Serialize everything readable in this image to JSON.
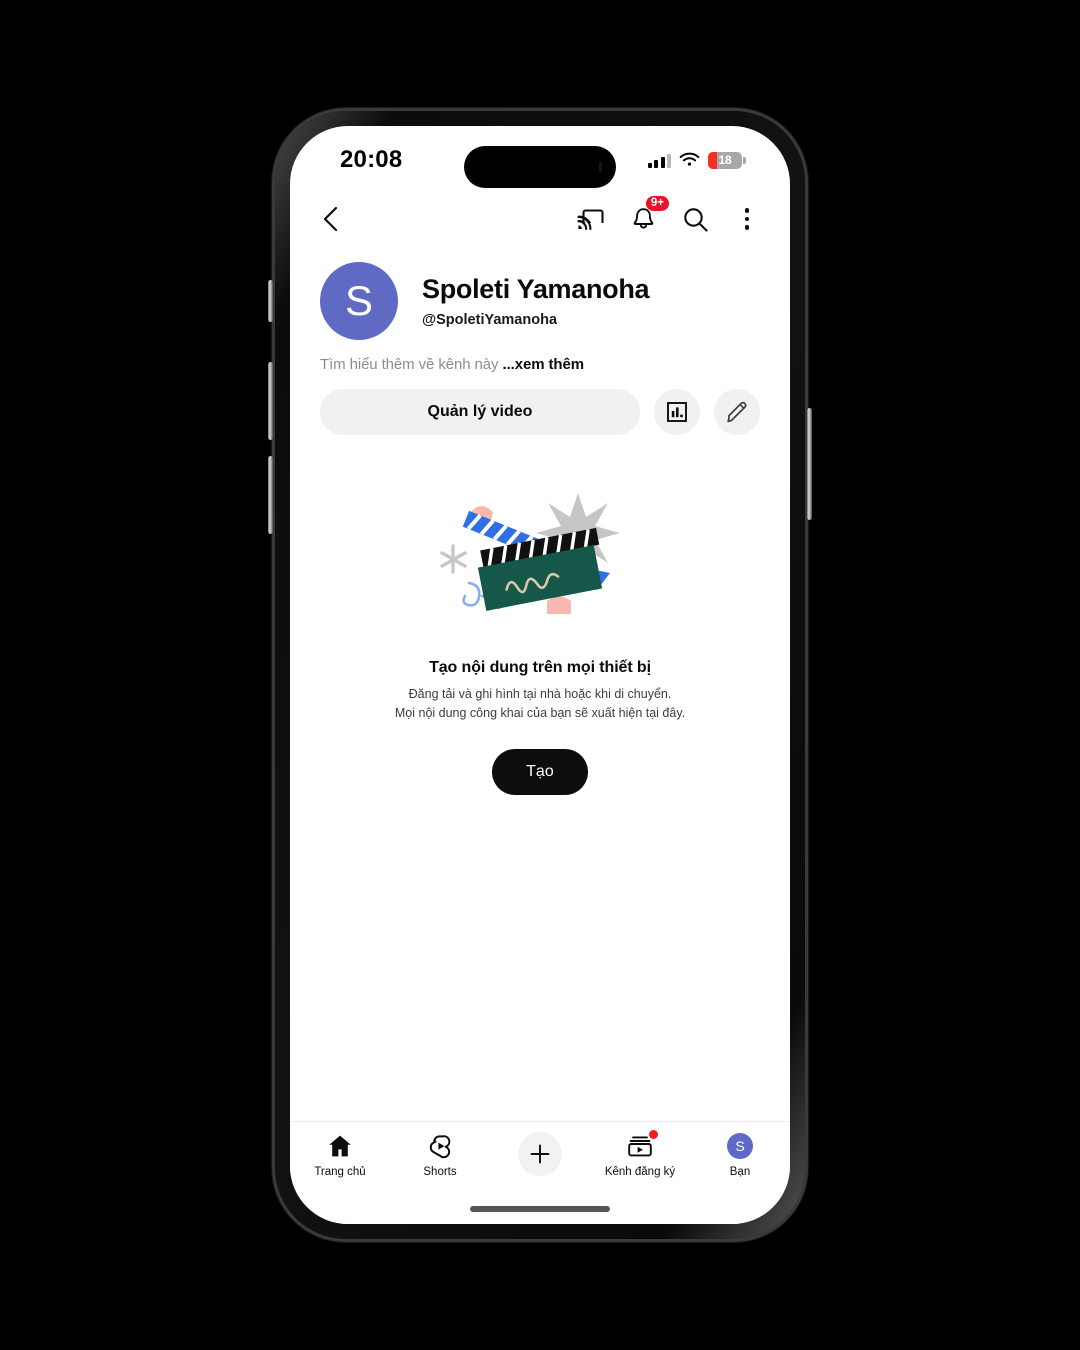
{
  "status_bar": {
    "time": "20:08",
    "signal_icon": "cellular-signal-icon",
    "wifi_icon": "wifi-icon",
    "battery_level": "18",
    "battery_low": true
  },
  "top_nav": {
    "back_icon": "back-arrow-icon",
    "cast_icon": "cast-icon",
    "notifications_icon": "bell-icon",
    "notifications_badge": "9+",
    "search_icon": "search-icon",
    "more_icon": "more-vertical-icon"
  },
  "channel": {
    "avatar_initial": "S",
    "avatar_color": "#5f6ac4",
    "name": "Spoleti Yamanoha",
    "handle": "@SpoletiYamanoha",
    "description": "Tìm hiểu thêm về kênh này",
    "description_more": "...xem thêm"
  },
  "actions": {
    "manage_videos_label": "Quản lý video",
    "analytics_icon": "bar-chart-icon",
    "edit_icon": "pencil-icon"
  },
  "empty_state": {
    "illustration_icon": "clapperboard-illustration",
    "title": "Tạo nội dung trên mọi thiết bị",
    "subtitle_line1": "Đăng tải và ghi hình tại nhà hoặc khi di chuyển.",
    "subtitle_line2": "Mọi nội dung công khai của bạn sẽ xuất hiện tại đây.",
    "create_label": "Tạo"
  },
  "bottom_nav": {
    "items": [
      {
        "label": "Trang chủ",
        "icon": "home-icon"
      },
      {
        "label": "Shorts",
        "icon": "shorts-icon"
      },
      {
        "label": "",
        "icon": "plus-icon"
      },
      {
        "label": "Kênh đăng ký",
        "icon": "subscriptions-icon",
        "has_dot": true
      },
      {
        "label": "Bạn",
        "icon": "account-avatar-icon",
        "avatar_initial": "S"
      }
    ]
  }
}
